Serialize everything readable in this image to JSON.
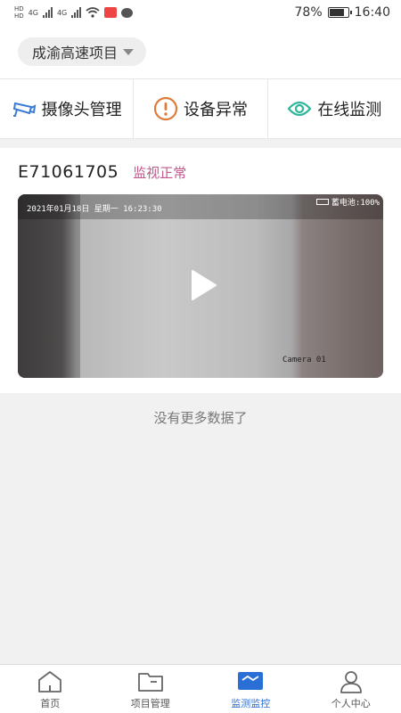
{
  "status_bar": {
    "left_indicators": [
      "HD",
      "HD",
      "4G",
      "4G"
    ],
    "battery": "78%",
    "battery_level": 0.78,
    "time": "16:40"
  },
  "header": {
    "project_name": "成渝高速项目"
  },
  "quick_actions": [
    {
      "label": "摄像头管理",
      "icon": "camera-icon",
      "color": "#3a7bd5"
    },
    {
      "label": "设备异常",
      "icon": "alert-icon",
      "color": "#e07a3a"
    },
    {
      "label": "在线监测",
      "icon": "eye-icon",
      "color": "#2fb59a"
    }
  ],
  "camera": {
    "id": "E71061705",
    "status": "监视正常",
    "status_color": "#c0578a",
    "video": {
      "timestamp": "2021年01月18日 星期一 16:23:30",
      "battery_label": "蓄电池:100%",
      "camera_name": "Camera 01"
    }
  },
  "list_footer": "没有更多数据了",
  "bottom_nav": [
    {
      "label": "首页",
      "icon": "home-icon",
      "active": false
    },
    {
      "label": "项目管理",
      "icon": "folder-icon",
      "active": false
    },
    {
      "label": "监测监控",
      "icon": "monitor-icon",
      "active": true
    },
    {
      "label": "个人中心",
      "icon": "user-icon",
      "active": false
    }
  ],
  "colors": {
    "accent": "#2a6fd6",
    "background": "#f1f1f1"
  }
}
